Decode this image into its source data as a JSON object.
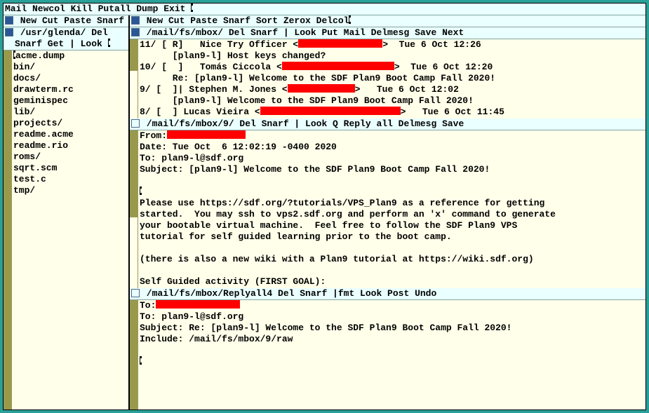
{
  "main_tag": "Mail Newcol Kill Putall Dump Exit ",
  "left": {
    "col_tag": " New Cut Paste Snarf",
    "dir": {
      "tag": " /usr/glenda/ Del Snarf Get | Look ",
      "files": [
        "acme.dump",
        "bin/",
        "docs/",
        "drawterm.rc",
        "geminispec",
        "lib/",
        "projects/",
        "readme.acme",
        "readme.rio",
        "roms/",
        "sqrt.scm",
        "test.c",
        "tmp/"
      ]
    }
  },
  "right": {
    "col_tag": " New Cut Paste Snarf Sort Zerox Delcol",
    "mbox": {
      "tag": " /mail/fs/mbox/ Del Snarf | Look Put Mail Delmesg Save Next",
      "rows": [
        {
          "pre": "11/ [ R]   Nice Try Officer <",
          "rw": 120,
          "post": ">  Tue 6 Oct 12:26"
        },
        {
          "pre": "      [plan9-l] Host keys changed?",
          "rw": 0,
          "post": ""
        },
        {
          "pre": "10/ [  ]   Tomás Ciccola <",
          "rw": 160,
          "post": ">  Tue 6 Oct 12:20"
        },
        {
          "pre": "      Re: [plan9-l] Welcome to the SDF Plan9 Boot Camp Fall 2020!",
          "rw": 0,
          "post": ""
        },
        {
          "pre": "9/ [  ]| Stephen M. Jones <",
          "rw": 96,
          "post": ">   Tue 6 Oct 12:02"
        },
        {
          "pre": "      [plan9-l] Welcome to the SDF Plan9 Boot Camp Fall 2020!",
          "rw": 0,
          "post": ""
        },
        {
          "pre": "8/ [  ] Lucas Vieira <",
          "rw": 200,
          "post": ">   Tue 6 Oct 11:45"
        }
      ]
    },
    "msg": {
      "tag": " /mail/fs/mbox/9/ Del Snarf | Look Q Reply all Delmesg Save",
      "from_label": "From:",
      "from_rw": 112,
      "lines": [
        "Date: Tue Oct  6 12:02:19 -0400 2020",
        "To: plan9-l@sdf.org",
        "Subject: [plan9-l] Welcome to the SDF Plan9 Boot Camp Fall 2020!",
        "",
        "",
        "Please use https://sdf.org/?tutorials/VPS_Plan9 as a reference for getting",
        "started.  You may ssh to vps2.sdf.org and perform an 'x' command to generate",
        "your bootable virtual machine.  Feel free to follow the SDF Plan9 VPS",
        "tutorial for self guided learning prior to the boot camp.",
        "",
        "(there is also a new wiki with a Plan9 tutorial at https://wiki.sdf.org)",
        "",
        "Self Guided activity (FIRST GOAL):"
      ]
    },
    "reply": {
      "tag": " /mail/fs/mbox/Replyall4 Del Snarf |fmt Look Post Undo",
      "to_label": "To:",
      "to_rw": 120,
      "lines": [
        "To: plan9-l@sdf.org",
        "Subject: Re: [plan9-l] Welcome to the SDF Plan9 Boot Camp Fall 2020!",
        "Include: /mail/fs/mbox/9/raw",
        ""
      ]
    }
  }
}
